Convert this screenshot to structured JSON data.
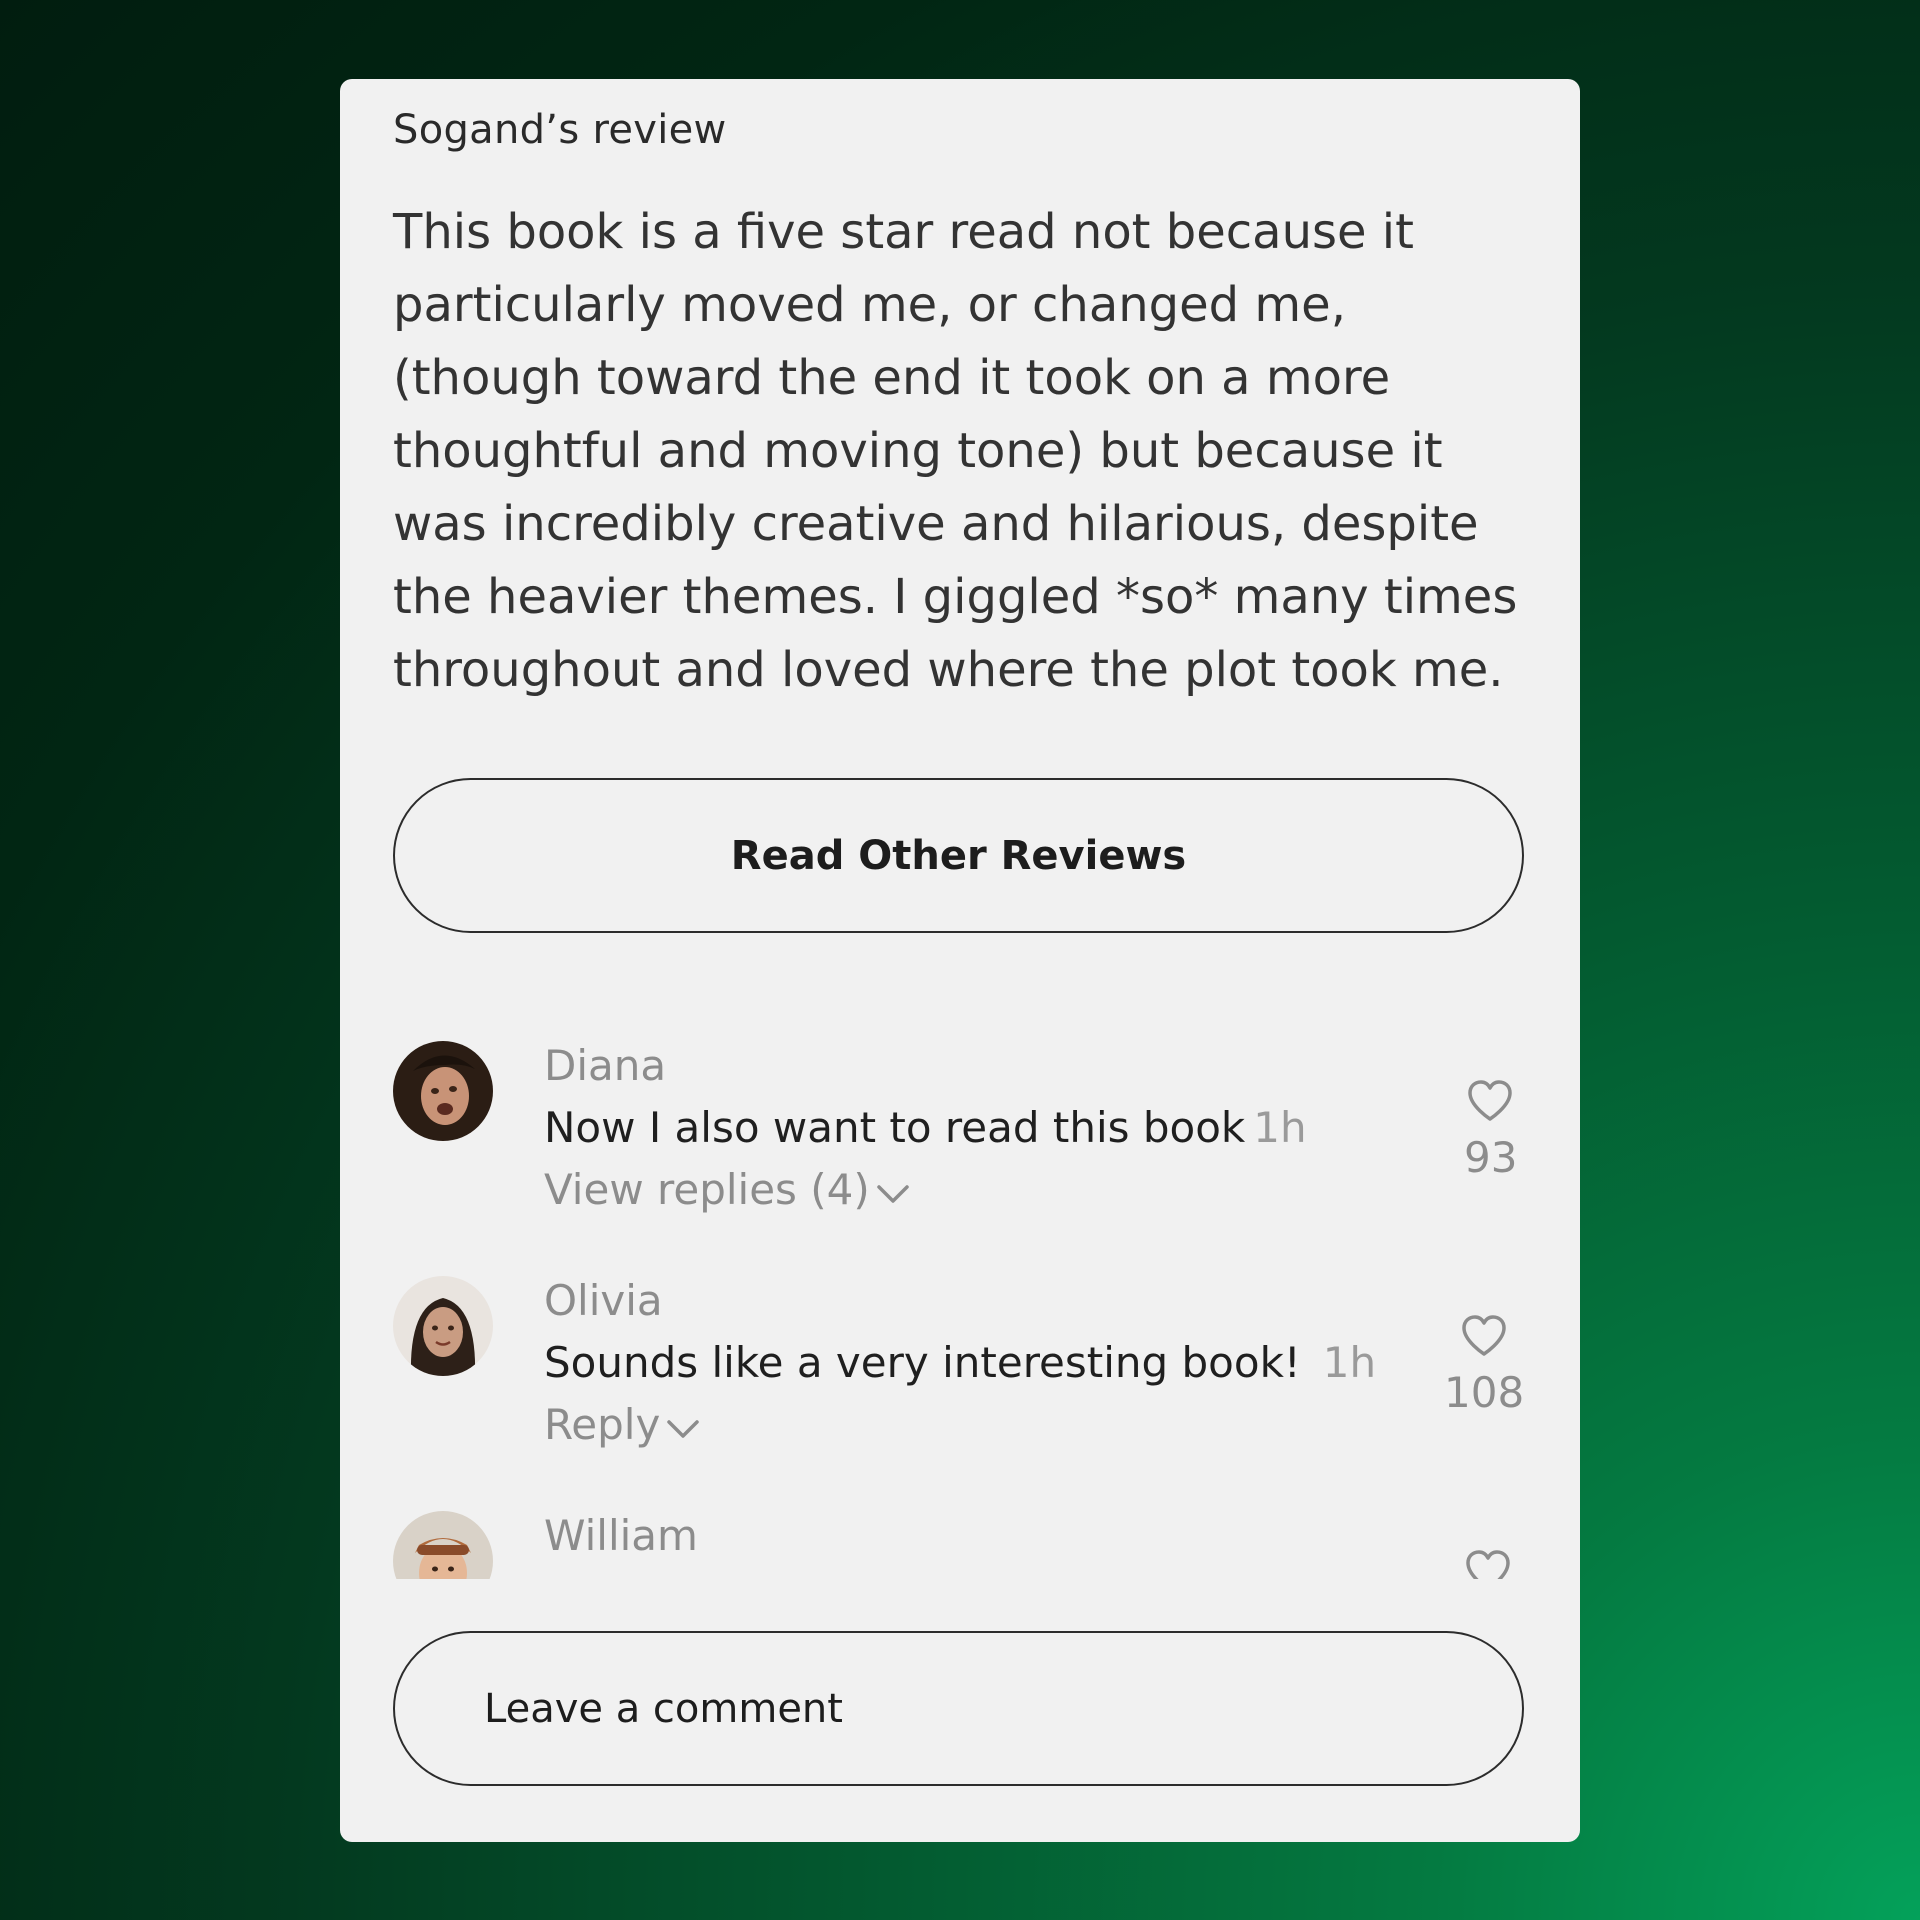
{
  "review": {
    "title": "Sogand’s review",
    "body": "This book is a five star read not because it particularly moved me, or changed me, (though toward the end it took on a more thoughtful and moving tone) but because it was incredibly creative and hilarious, despite the heavier themes. I giggled *so* many times throughout and loved where the plot took me."
  },
  "read_other_label": "Read Other Reviews",
  "comments": [
    {
      "name": "Diana",
      "text": "Now I also want to read this book",
      "time": "1h",
      "action": "View replies (4)",
      "likes": "93",
      "avatar_colors": [
        "#2b1d14",
        "#c89377"
      ]
    },
    {
      "name": "Olivia",
      "text": "Sounds like a very interesting book!",
      "time": "1h",
      "action": "Reply",
      "likes": "108",
      "avatar_colors": [
        "#2d2018",
        "#c99c82"
      ]
    },
    {
      "name": "William",
      "text": "",
      "time": "",
      "action": "",
      "likes": "",
      "avatar_colors": [
        "#b06a3c",
        "#e5b796"
      ]
    }
  ],
  "leave_comment_placeholder": "Leave a comment",
  "icons": {
    "like": "heart-icon",
    "expand": "chevron-down-icon"
  },
  "colors": {
    "background_dark": "#011d0f",
    "background_accent": "#04a15a",
    "card": "#f1f1f1"
  }
}
